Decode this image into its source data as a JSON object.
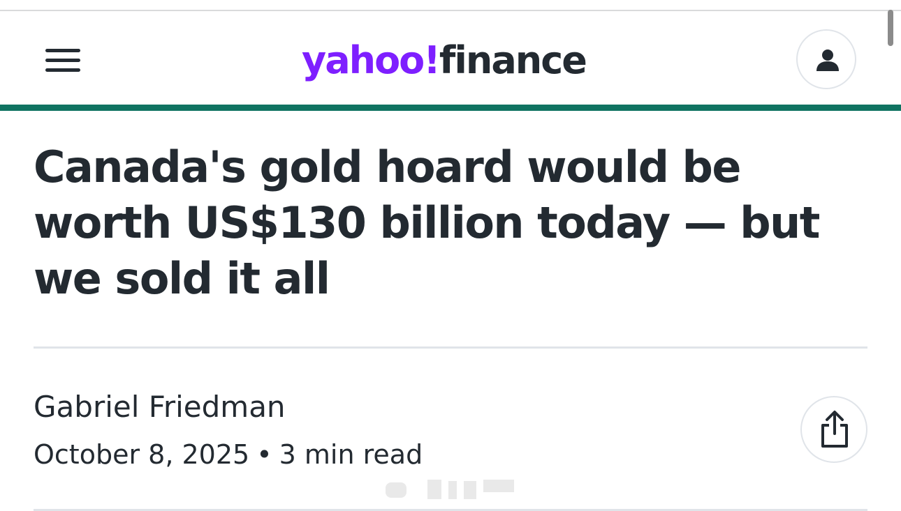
{
  "header": {
    "logo": {
      "brand": "yahoo!",
      "section": "finance"
    },
    "menu_icon": "hamburger-menu-icon",
    "account_icon": "user-icon",
    "colors": {
      "brand_purple": "#7e1fff",
      "accent_green": "#0f7361",
      "text_dark": "#232a31"
    }
  },
  "article": {
    "headline": "Canada's gold hoard would be worth US$130 billion today — but we sold it all",
    "author": "Gabriel Friedman",
    "date": "October 8, 2025",
    "separator": "•",
    "read_time": "3 min read",
    "share_icon": "share-icon"
  }
}
